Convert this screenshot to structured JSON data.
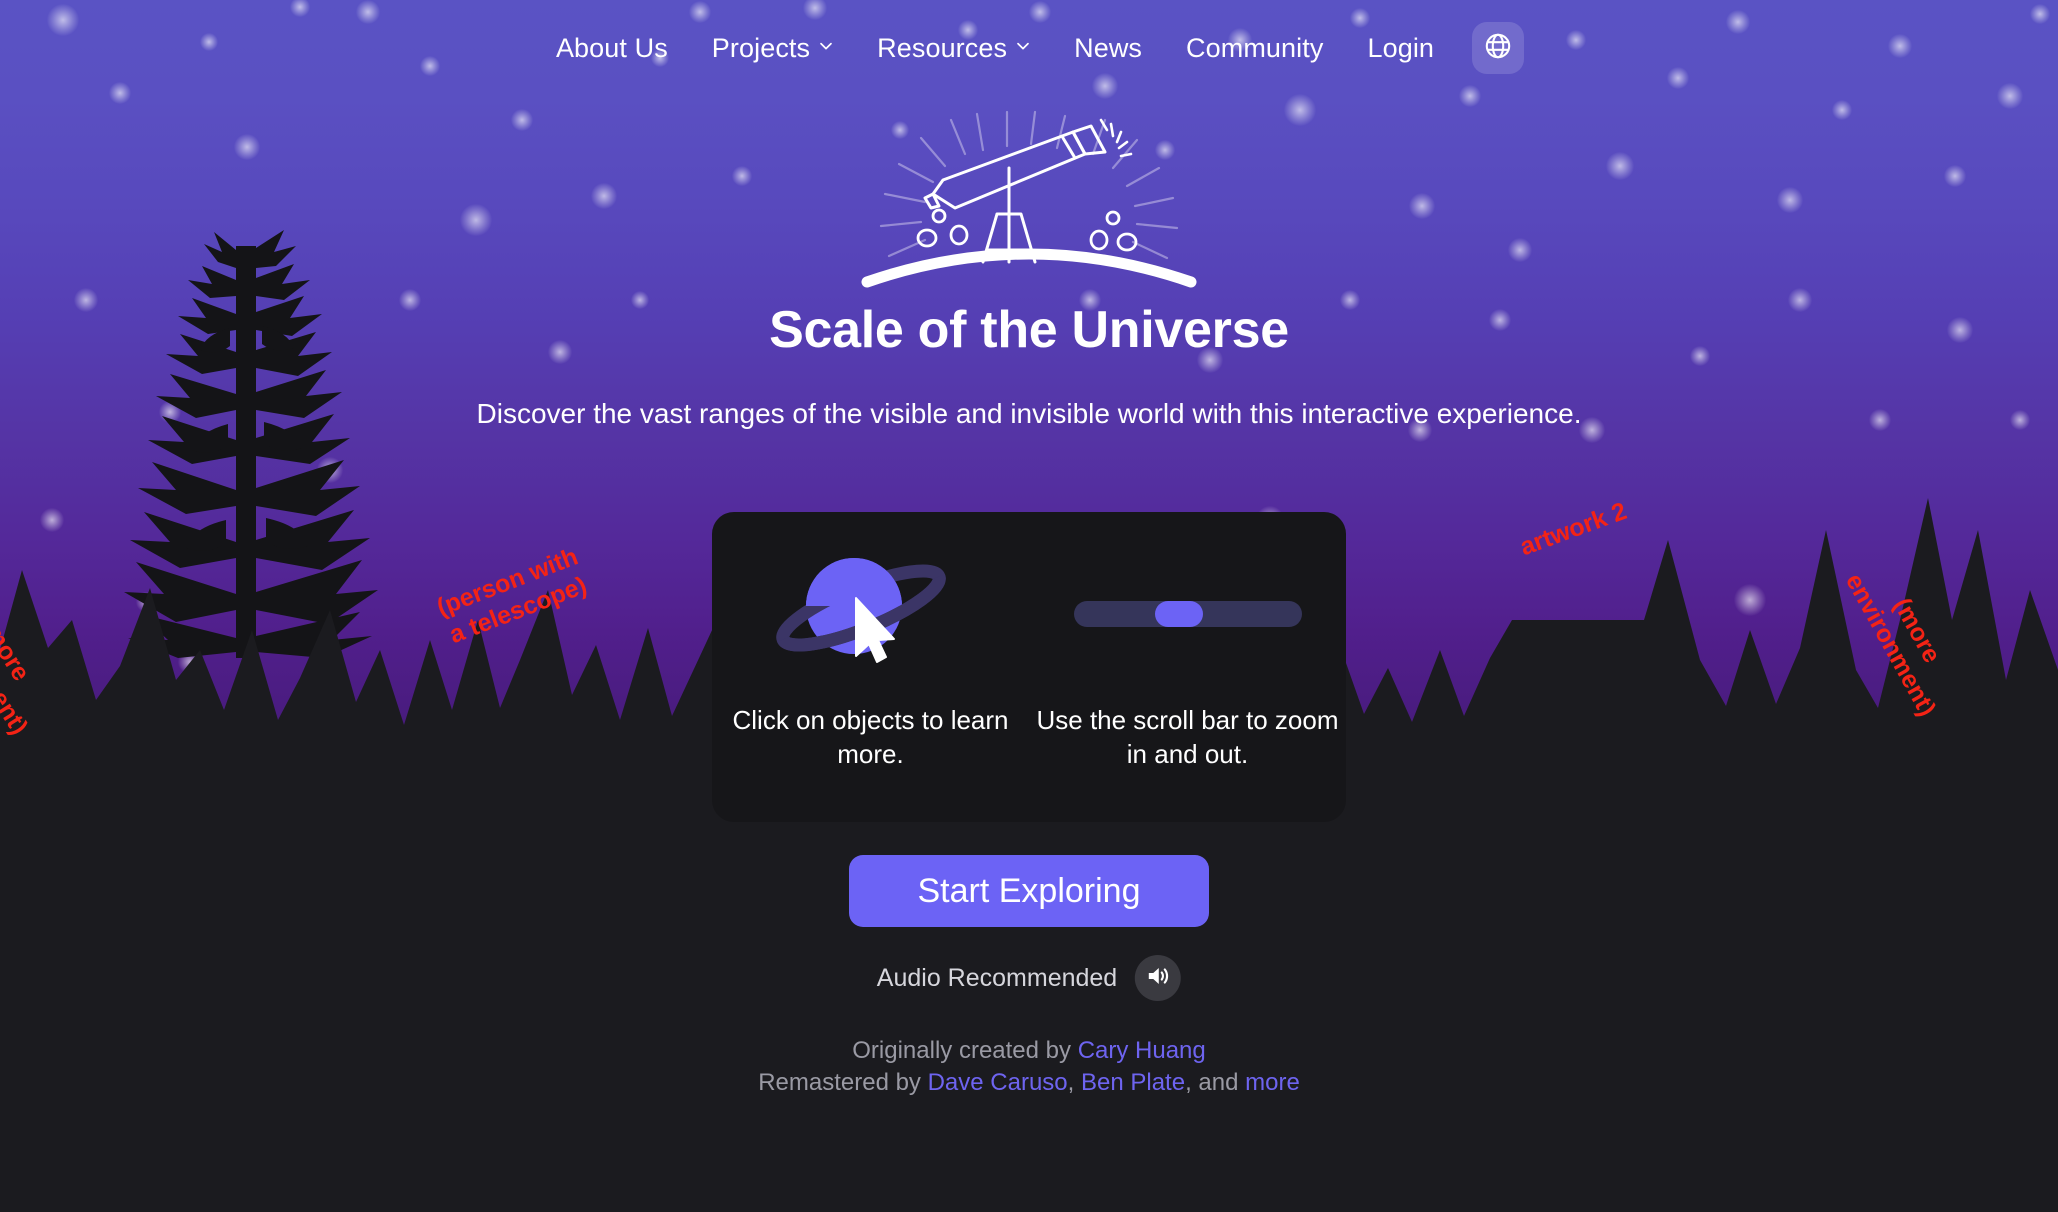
{
  "nav": {
    "items": [
      {
        "label": "About Us",
        "has_chevron": false,
        "icon": null
      },
      {
        "label": "Projects",
        "has_chevron": true,
        "icon": "chevron-down-icon"
      },
      {
        "label": "Resources",
        "has_chevron": true,
        "icon": "chevron-down-icon"
      },
      {
        "label": "News",
        "has_chevron": false,
        "icon": null
      },
      {
        "label": "Community",
        "has_chevron": false,
        "icon": null
      },
      {
        "label": "Login",
        "has_chevron": false,
        "icon": null
      }
    ],
    "language_button_icon": "globe-icon"
  },
  "hero": {
    "logo_icon": "telescope-on-hill-icon",
    "title": "Scale of the Universe",
    "subtitle": "Discover the vast ranges of the visible and invisible world with this interactive experience."
  },
  "instructions": {
    "left": {
      "icon": "ringed-planet-icon",
      "cursor_icon": "mouse-cursor-icon",
      "text": "Click on objects to learn more."
    },
    "right": {
      "icon": "zoom-scrollbar-icon",
      "slider_value_pct": 36,
      "text": "Use the scroll bar to zoom in and out."
    }
  },
  "cta": {
    "start_label": "Start Exploring",
    "audio_label": "Audio Recommended",
    "audio_icon": "speaker-on-icon"
  },
  "credits": {
    "line1_prefix": "Originally created by ",
    "line1_link": "Cary Huang",
    "line2_prefix": "Remastered by ",
    "line2_link1": "Dave Caruso",
    "line2_sep1": ", ",
    "line2_link2": "Ben Plate",
    "line2_sep2": ", and ",
    "line2_link3": "more"
  },
  "annotations": [
    {
      "id": "anno-left",
      "text": "(more environment)"
    },
    {
      "id": "anno-tele",
      "text": "(person with a telescope)"
    },
    {
      "id": "anno-art2",
      "text": "artwork 2"
    },
    {
      "id": "anno-right",
      "text": "(more environment)"
    }
  ],
  "colors": {
    "accent_purple": "#6c63f5",
    "sky_top": "#5a53c4",
    "sky_bottom": "#3a1866",
    "card_bg": "#161619",
    "page_bg": "#1e1e22",
    "annotation_red": "#f42315",
    "link_purple": "#6e64f0",
    "silhouette": "#1b1b1f"
  }
}
